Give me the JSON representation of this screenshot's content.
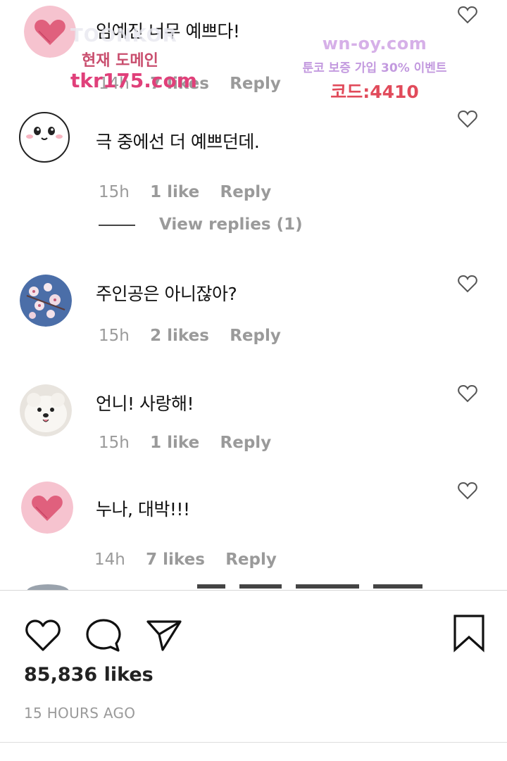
{
  "comments": [
    {
      "avatar": "heart-avatar",
      "text": "임예진 너무 예쁘다!",
      "time": "14h",
      "likes": "7 likes",
      "reply": "Reply"
    },
    {
      "avatar": "cartoon-face-avatar",
      "text": "극 중에선 더 예쁘던데.",
      "time": "15h",
      "likes": "1 like",
      "reply": "Reply",
      "view_replies": "View replies (1)"
    },
    {
      "avatar": "cherry-blossom-avatar",
      "text": "주인공은 아니잖아?",
      "time": "15h",
      "likes": "2 likes",
      "reply": "Reply"
    },
    {
      "avatar": "white-dog-avatar",
      "text": "언니! 사랑해!",
      "time": "15h",
      "likes": "1 like",
      "reply": "Reply"
    },
    {
      "avatar": "heart-avatar",
      "text": "누나, 대박!!!",
      "time": "14h",
      "likes": "7 likes",
      "reply": "Reply"
    }
  ],
  "watermark_left": {
    "logo": "TOONKOR",
    "label": "현재 도메인",
    "domain": "tkr175.com"
  },
  "watermark_right": {
    "site": "wn-oy.com",
    "event": "툰코 보증 가입 30% 이벤트",
    "code": "코드:4410"
  },
  "post": {
    "likes": "85,836 likes",
    "timestamp": "15 HOURS AGO"
  },
  "icons": {
    "like": "heart-icon",
    "comment": "comment-icon",
    "share": "send-icon",
    "save": "bookmark-icon"
  },
  "colors": {
    "meta_text": "#9a9a9a",
    "watermark_pink": "#e0407a",
    "watermark_purple": "#c39adf"
  }
}
